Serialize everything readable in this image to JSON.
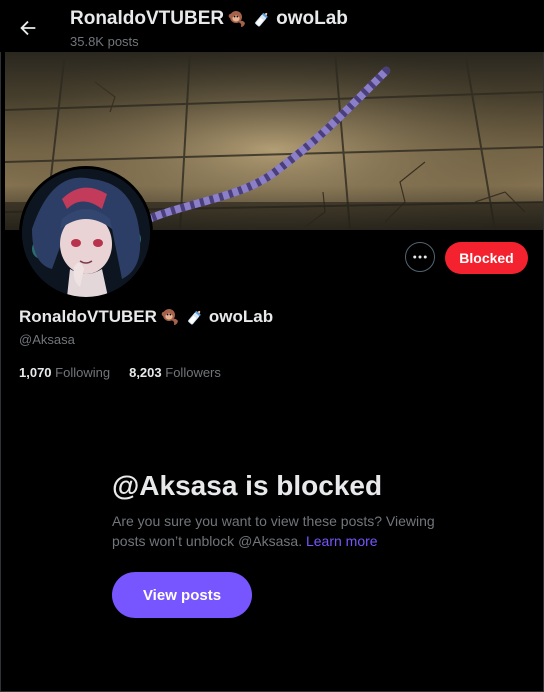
{
  "header": {
    "title_name": "RonaldoVTUBER",
    "title_suffix": "owoLab",
    "posts_count": "35.8K posts"
  },
  "profile": {
    "display_name": "RonaldoVTUBER",
    "name_suffix": "owoLab",
    "handle": "@Aksasa",
    "following_count": "1,070",
    "following_label": "Following",
    "followers_count": "8,203",
    "followers_label": "Followers"
  },
  "actions": {
    "blocked_label": "Blocked"
  },
  "blocked_notice": {
    "title": "@Aksasa is blocked",
    "description": "Are you sure you want to view these posts? Viewing posts won’t unblock @Aksasa.",
    "learn_more": "Learn more",
    "view_posts_label": "View posts"
  },
  "icons": {
    "back": "arrow-left-icon",
    "more": "more-horizontal-icon",
    "name_emojis": [
      "monkey-emoji",
      "baby-bottle-emoji"
    ]
  },
  "colors": {
    "blocked_button": "#f4212e",
    "accent": "#7856ff",
    "muted_text": "#71767b",
    "primary_text": "#e7e9ea"
  }
}
